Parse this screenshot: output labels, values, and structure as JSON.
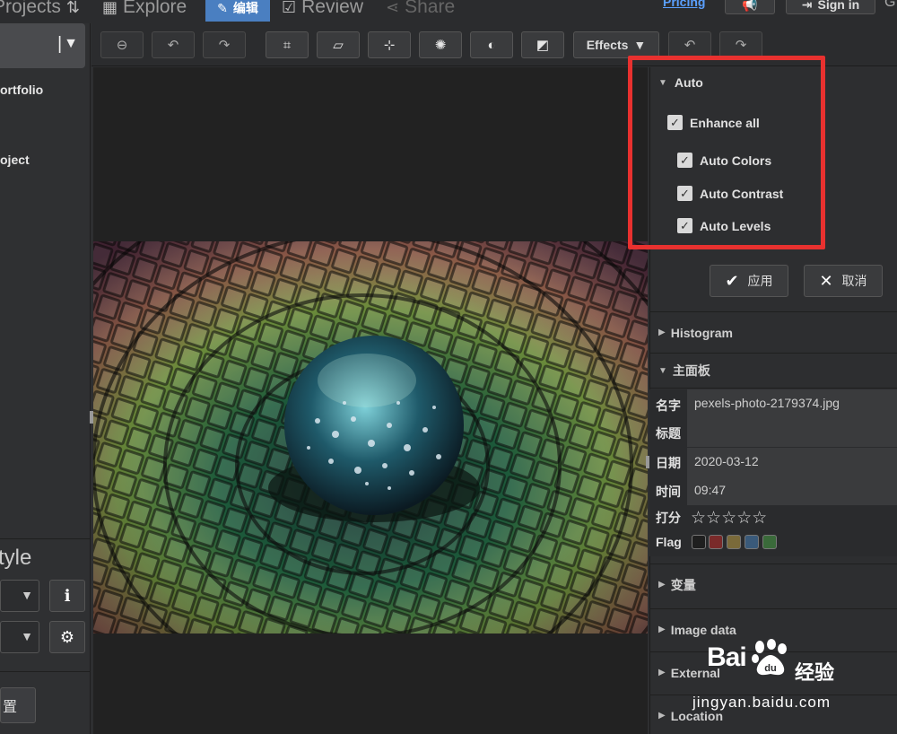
{
  "nav": {
    "projects_label": "Projects",
    "explore_label": "Explore",
    "edit_label": "编辑",
    "review_label": "Review",
    "share_label": "Share",
    "pricing_label": "Pricing",
    "signin_label": "Sign in"
  },
  "sidebar": {
    "portfolio_label": "ortfolio",
    "project_label": "oject",
    "style_label": "tyle",
    "bottom_button_label": "置"
  },
  "toolbar": {
    "effects_label": "Effects"
  },
  "auto_panel": {
    "title": "Auto",
    "enhance_all": "Enhance all",
    "options": [
      "Auto Colors",
      "Auto Contrast",
      "Auto Levels"
    ],
    "apply_label": "应用",
    "cancel_label": "取消"
  },
  "sections": {
    "histogram": "Histogram",
    "main_panel": "主面板",
    "variables": "变量",
    "image_data": "Image data",
    "external": "External",
    "location": "Location"
  },
  "metadata": {
    "name_label": "名字",
    "name_value": "pexels-photo-2179374.jpg",
    "title_label": "标题",
    "title_value": "",
    "date_label": "日期",
    "date_value": "2020-03-12",
    "time_label": "时间",
    "time_value": "09:47",
    "rating_label": "打分",
    "rating_stars": "☆☆☆☆☆",
    "rating_value": 0,
    "flag_label": "Flag",
    "flag_colors": [
      "#1f1f1f",
      "#7a2a2a",
      "#7a6a3a",
      "#3a5a7a",
      "#3a6a3a"
    ]
  },
  "watermark": {
    "brand": "Bai",
    "brand_suffix": "du",
    "cn": "经验",
    "url": "jingyan.baidu.com"
  },
  "colors": {
    "accent": "#4a7fc1",
    "highlight_box": "#e8312f",
    "link": "#5aa0ff"
  }
}
